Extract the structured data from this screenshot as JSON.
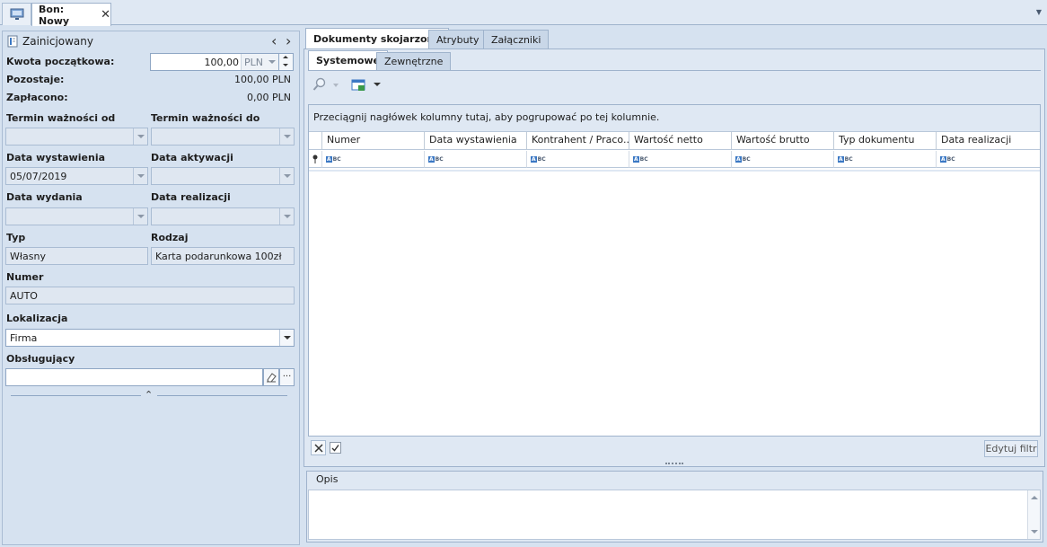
{
  "window": {
    "tab_title": "Bon: Nowy",
    "tab_close": "✕"
  },
  "left": {
    "status": "Zainicjowany",
    "nav_prev": "‹",
    "nav_next": "›",
    "kwota_label": "Kwota początkowa:",
    "kwota_value": "100,00",
    "kwota_currency": "PLN",
    "pozostaje_label": "Pozostaje:",
    "pozostaje_value": "100,00 PLN",
    "zaplacono_label": "Zapłacono:",
    "zaplacono_value": "0,00 PLN",
    "termin_od_label": "Termin ważności od",
    "termin_do_label": "Termin ważności do",
    "data_wystawienia_label": "Data wystawienia",
    "data_wystawienia_value": "05/07/2019",
    "data_aktywacji_label": "Data aktywacji",
    "data_wydania_label": "Data wydania",
    "data_realizacji_label": "Data realizacji",
    "typ_label": "Typ",
    "typ_value": "Własny",
    "rodzaj_label": "Rodzaj",
    "rodzaj_value": "Karta podarunkowa 100zł",
    "numer_label": "Numer",
    "numer_value": "AUTO",
    "lokalizacja_label": "Lokalizacja",
    "lokalizacja_value": "Firma",
    "obslugujacy_label": "Obsługujący",
    "ellipsis": "···",
    "splitter_glyph": "⌃"
  },
  "right": {
    "tabs": [
      "Dokumenty skojarzone",
      "Atrybuty",
      "Załączniki"
    ],
    "subtabs": [
      "Systemowe",
      "Zewnętrzne"
    ],
    "group_hint": "Przeciągnij nagłówek kolumny tutaj, aby pogrupować po tej kolumnie.",
    "columns": [
      "Numer",
      "Data wystawienia",
      "Kontrahent / Praco...",
      "Wartość netto",
      "Wartość brutto",
      "Typ dokumentu",
      "Data realizacji"
    ],
    "filter_glyph_a": "A",
    "filter_glyph_bc": "BC",
    "edit_filter": "Edytuj filtr",
    "opis_label": "Opis"
  },
  "colors": {
    "accent": "#3b78c4",
    "panel_bg": "#d6e2f0",
    "border": "#9fb3cc"
  }
}
